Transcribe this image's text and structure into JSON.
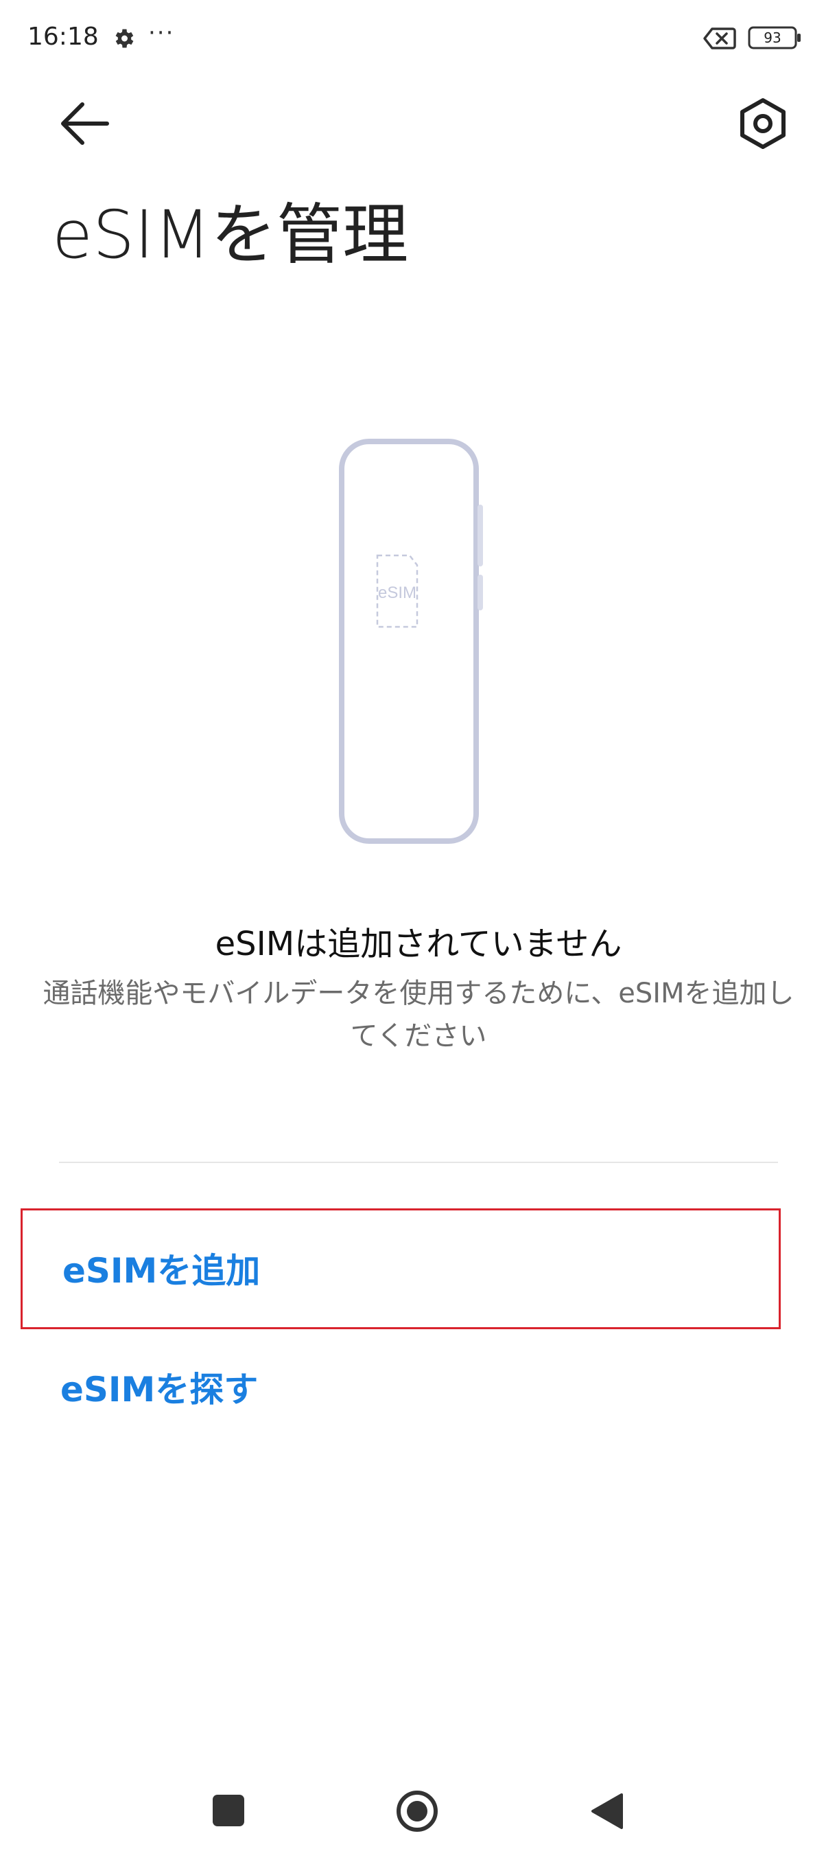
{
  "status_bar": {
    "time": "16:18",
    "more": "···",
    "battery": "93",
    "icons": [
      "gear-icon",
      "no-sim-icon",
      "battery-icon"
    ]
  },
  "header": {
    "back_icon": "arrow-left-icon",
    "settings_icon": "settings-hexagon-icon"
  },
  "page": {
    "title": "eSIMを管理"
  },
  "illustration": {
    "sim_label": "eSIM",
    "color": "#c5c9dd"
  },
  "empty_state": {
    "title": "eSIMは追加されていません",
    "description": "通話機能やモバイルデータを使用するために、eSIMを追加してください"
  },
  "actions": {
    "add": "eSIMを追加",
    "find": "eSIMを探す"
  },
  "colors": {
    "accent": "#1a7fe0",
    "highlight_border": "#d9232d"
  },
  "nav": {
    "icons": [
      "recents-square-icon",
      "home-circle-icon",
      "back-triangle-icon"
    ]
  }
}
